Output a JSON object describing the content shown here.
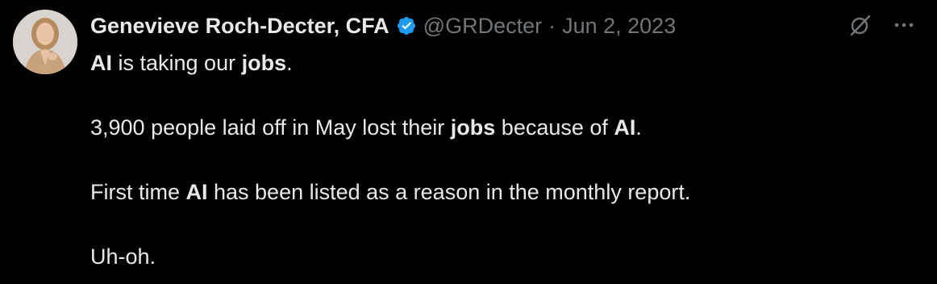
{
  "author": {
    "display_name": "Genevieve Roch-Decter, CFA",
    "handle": "@GRDecter",
    "separator": "·",
    "date": "Jun 2, 2023"
  },
  "colors": {
    "background": "#000000",
    "text_primary": "#e7e9ea",
    "text_secondary": "#71767b",
    "verified_badge": "#1d9bf0"
  },
  "icons": {
    "verified": "verified-badge-icon",
    "grok": "grok-icon",
    "more": "more-options-icon"
  },
  "tweet": {
    "p1": {
      "a": "AI",
      "b": " is taking our ",
      "c": "jobs",
      "d": "."
    },
    "p2": {
      "a": "3,900 people laid off in May lost their ",
      "b": "jobs",
      "c": " because of ",
      "d": "AI",
      "e": "."
    },
    "p3": {
      "a": "First time ",
      "b": "AI",
      "c": " has been listed as a reason in the monthly report."
    },
    "p4": {
      "a": "Uh-oh."
    }
  }
}
